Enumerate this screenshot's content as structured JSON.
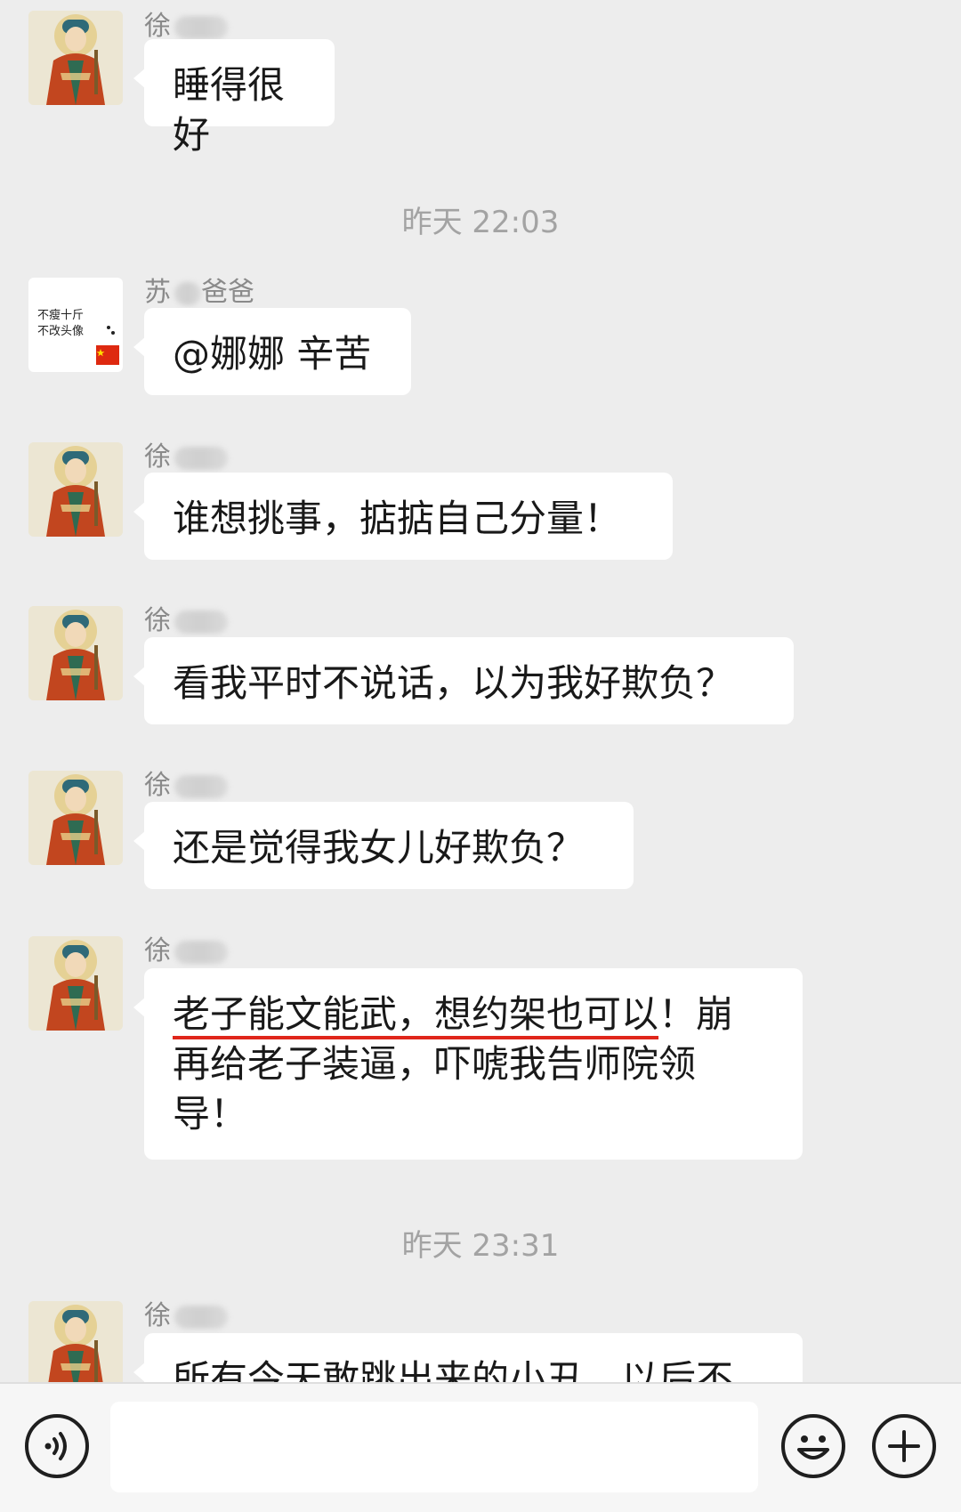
{
  "chat": {
    "messages": [
      {
        "sender": "徐",
        "avatar": "buddha-avatar",
        "text": "睡得很好"
      },
      {
        "sender": "苏",
        "sender_suffix": "爸爸",
        "avatar": "text-image-avatar",
        "avatar_text_line1": "不瘦十斤",
        "avatar_text_line2": "不改头像",
        "text": "@娜娜 辛苦"
      },
      {
        "sender": "徐",
        "avatar": "buddha-avatar",
        "text": "谁想挑事，掂掂自己分量！"
      },
      {
        "sender": "徐",
        "avatar": "buddha-avatar",
        "text": "看我平时不说话，以为我好欺负？"
      },
      {
        "sender": "徐",
        "avatar": "buddha-avatar",
        "text": "还是觉得我女儿好欺负？"
      },
      {
        "sender": "徐",
        "avatar": "buddha-avatar",
        "text_underlined": "老子能文能武，想约架也可以",
        "text_rest_line1": "！崩",
        "text_line2": "再给老子装逼，吓唬我告师院领",
        "text_line3": "导！"
      },
      {
        "sender": "徐",
        "avatar": "buddha-avatar",
        "text": "所有今天敢跳出来的小丑，以后不"
      }
    ],
    "timestamps": [
      "昨天 22:03",
      "昨天 23:31"
    ]
  },
  "input_bar": {
    "voice_icon": "voice-icon",
    "emoji_icon": "emoji-icon",
    "plus_icon": "plus-icon"
  },
  "colors": {
    "background": "#ededed",
    "bubble": "#ffffff",
    "underline": "#e0261b",
    "timestamp_text": "#a3a3a3"
  }
}
